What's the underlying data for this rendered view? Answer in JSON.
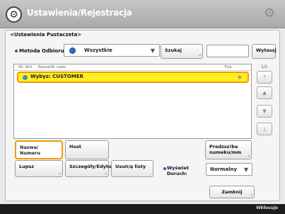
{
  "header": {
    "title": "Ustawienia/Rejestracja",
    "left_icon": "gear-settings-icon",
    "right_icon": "settings-icon"
  },
  "breadcrumb": "<Ustawienia Pustaczeta>",
  "method": {
    "label": "Metoda Odbioru:",
    "selected": "Wszystkie"
  },
  "buttons": {
    "search": "Szukaj",
    "back": "Wytaszj",
    "name_label": "Nazwa/\nNumeru",
    "host": "Host",
    "prefix": "Predzsz!be\nnumeku/mm",
    "copy": "Lupsz",
    "details": "Szczegóły/Edytuj",
    "delete": "Usuń/ą listy",
    "close": "Zamknij"
  },
  "list": {
    "headers": [
      "Wl. Wid",
      "Nazwa/Nr nadw",
      "Tryp"
    ],
    "rows": [
      {
        "text": "Wybyz: CUSTOMER",
        "selected": true
      }
    ]
  },
  "pager": "1/1",
  "display": {
    "label": "Wyświet\nDoruch:",
    "selected": "Normalny"
  },
  "footer": {
    "status": "Wkłosuje"
  },
  "colors": {
    "highlight": "#ffee22",
    "highlight_border": "#f29a00",
    "accent": "#1a64b8"
  }
}
